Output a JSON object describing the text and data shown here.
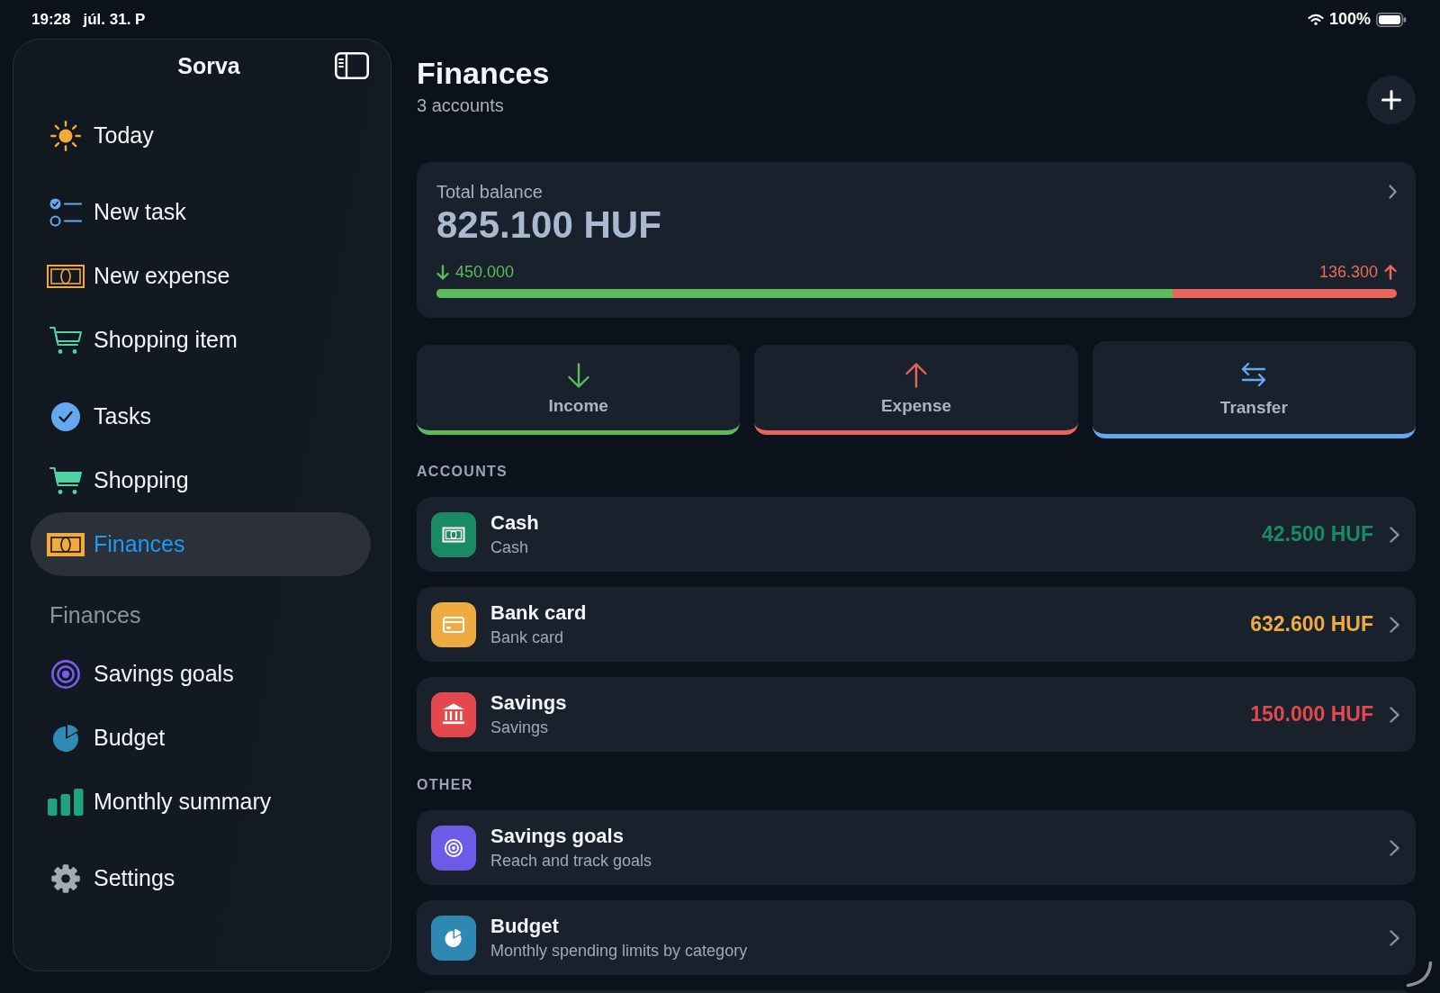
{
  "status_bar": {
    "time": "19:28",
    "date": "júl. 31. P",
    "battery": "100%"
  },
  "sidebar": {
    "title": "Sorva",
    "groups": [
      {
        "items": [
          {
            "label": "Today",
            "selected": false
          }
        ]
      },
      {
        "items": [
          {
            "label": "New task",
            "selected": false
          },
          {
            "label": "New expense",
            "selected": false
          },
          {
            "label": "Shopping item",
            "selected": false
          }
        ]
      },
      {
        "items": [
          {
            "label": "Tasks",
            "selected": false
          },
          {
            "label": "Shopping",
            "selected": false
          },
          {
            "label": "Finances",
            "selected": true
          }
        ]
      },
      {
        "heading": "Finances",
        "items": [
          {
            "label": "Savings goals",
            "selected": false
          },
          {
            "label": "Budget",
            "selected": false
          },
          {
            "label": "Monthly summary",
            "selected": false
          }
        ]
      },
      {
        "items": [
          {
            "label": "Settings",
            "selected": false
          }
        ]
      }
    ]
  },
  "header": {
    "title": "Finances",
    "subtitle": "3 accounts"
  },
  "balance": {
    "label": "Total balance",
    "amount": "825.100 HUF",
    "income": "450.000",
    "expense": "136.300",
    "level": 0.767
  },
  "actions": [
    {
      "label": "Income",
      "color": "#5cbc5c",
      "selected": false
    },
    {
      "label": "Expense",
      "color": "#e8645a",
      "selected": false
    },
    {
      "label": "Transfer",
      "color": "#64a9f0",
      "selected": true
    }
  ],
  "accounts": {
    "heading": "ACCOUNTS",
    "items": [
      {
        "name": "Cash",
        "type": "Cash",
        "balance": "42.500 HUF",
        "color": "#1a8a63"
      },
      {
        "name": "Bank card",
        "type": "Bank card",
        "balance": "632.600 HUF",
        "color": "#eeab40"
      },
      {
        "name": "Savings",
        "type": "Savings",
        "balance": "150.000 HUF",
        "color": "#e3494c"
      }
    ]
  },
  "other": {
    "heading": "OTHER",
    "items": [
      {
        "title": "Savings goals",
        "subtitle": "Reach and track goals",
        "color": "#6d5ae6"
      },
      {
        "title": "Budget",
        "subtitle": "Monthly spending limits by category",
        "color": "#2d89b2"
      }
    ]
  }
}
